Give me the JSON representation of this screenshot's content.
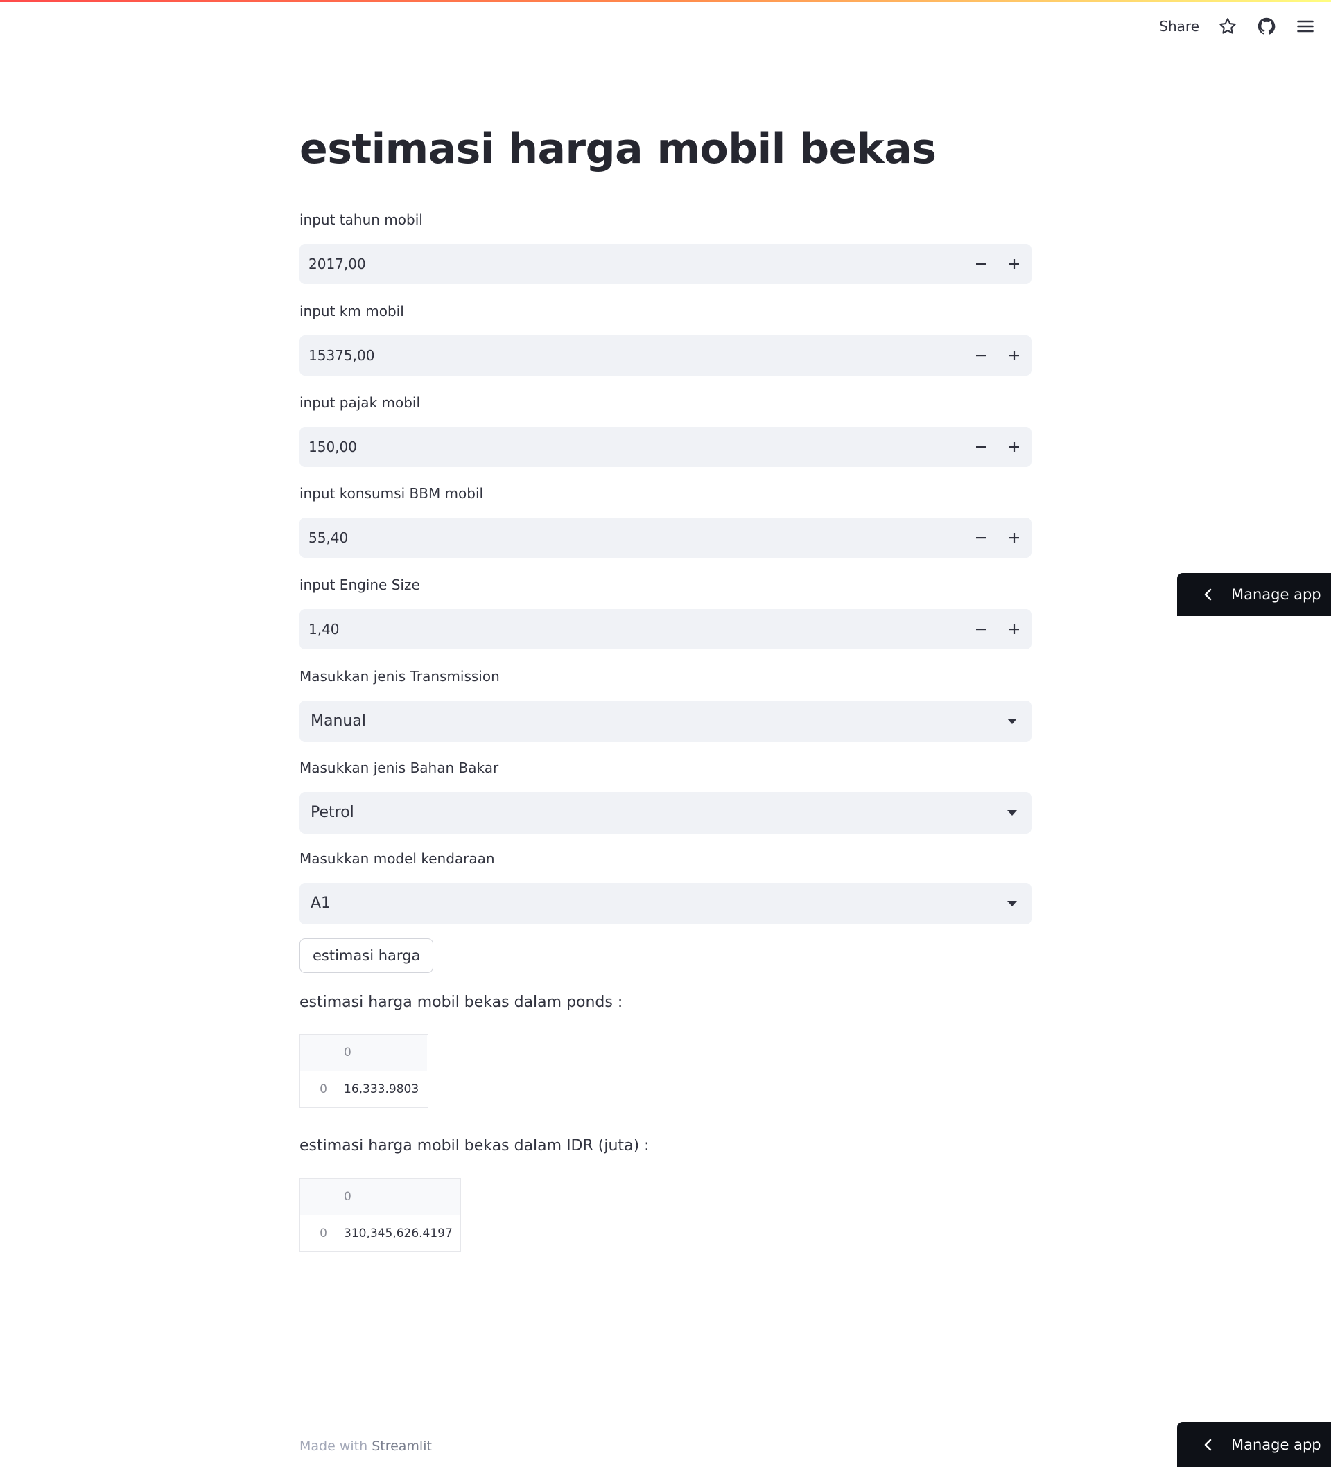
{
  "toolbar": {
    "share_label": "Share",
    "icons": [
      "star-icon",
      "github-icon",
      "hamburger-menu-icon"
    ]
  },
  "title": "estimasi harga mobil bekas",
  "number_inputs": [
    {
      "label": "input tahun mobil",
      "value": "2017,00"
    },
    {
      "label": "input km mobil",
      "value": "15375,00"
    },
    {
      "label": "input pajak mobil",
      "value": "150,00"
    },
    {
      "label": "input konsumsi BBM mobil",
      "value": "55,40"
    },
    {
      "label": "input Engine Size",
      "value": "1,40"
    }
  ],
  "selects": [
    {
      "label": "Masukkan jenis Transmission",
      "value": "Manual"
    },
    {
      "label": "Masukkan jenis Bahan Bakar",
      "value": "Petrol"
    },
    {
      "label": "Masukkan model kendaraan",
      "value": "A1"
    }
  ],
  "action_button_label": "estimasi harga",
  "results": [
    {
      "label": "estimasi harga mobil bekas dalam ponds :",
      "table": {
        "header": [
          "",
          "0"
        ],
        "rows": [
          [
            "0",
            "16,333.9803"
          ]
        ]
      }
    },
    {
      "label": "estimasi harga mobil bekas dalam IDR (juta) :",
      "table": {
        "header": [
          "",
          "0"
        ],
        "rows": [
          [
            "0",
            "310,345,626.4197"
          ]
        ]
      }
    }
  ],
  "manage_app_label": "Manage app",
  "footer": {
    "prefix": "Made with ",
    "brand": "Streamlit"
  },
  "colors": {
    "accent_gradient": [
      "#ff4b4b",
      "#fffd80"
    ],
    "input_background": "#f0f2f6",
    "manage_button_background": "#0e1117"
  }
}
